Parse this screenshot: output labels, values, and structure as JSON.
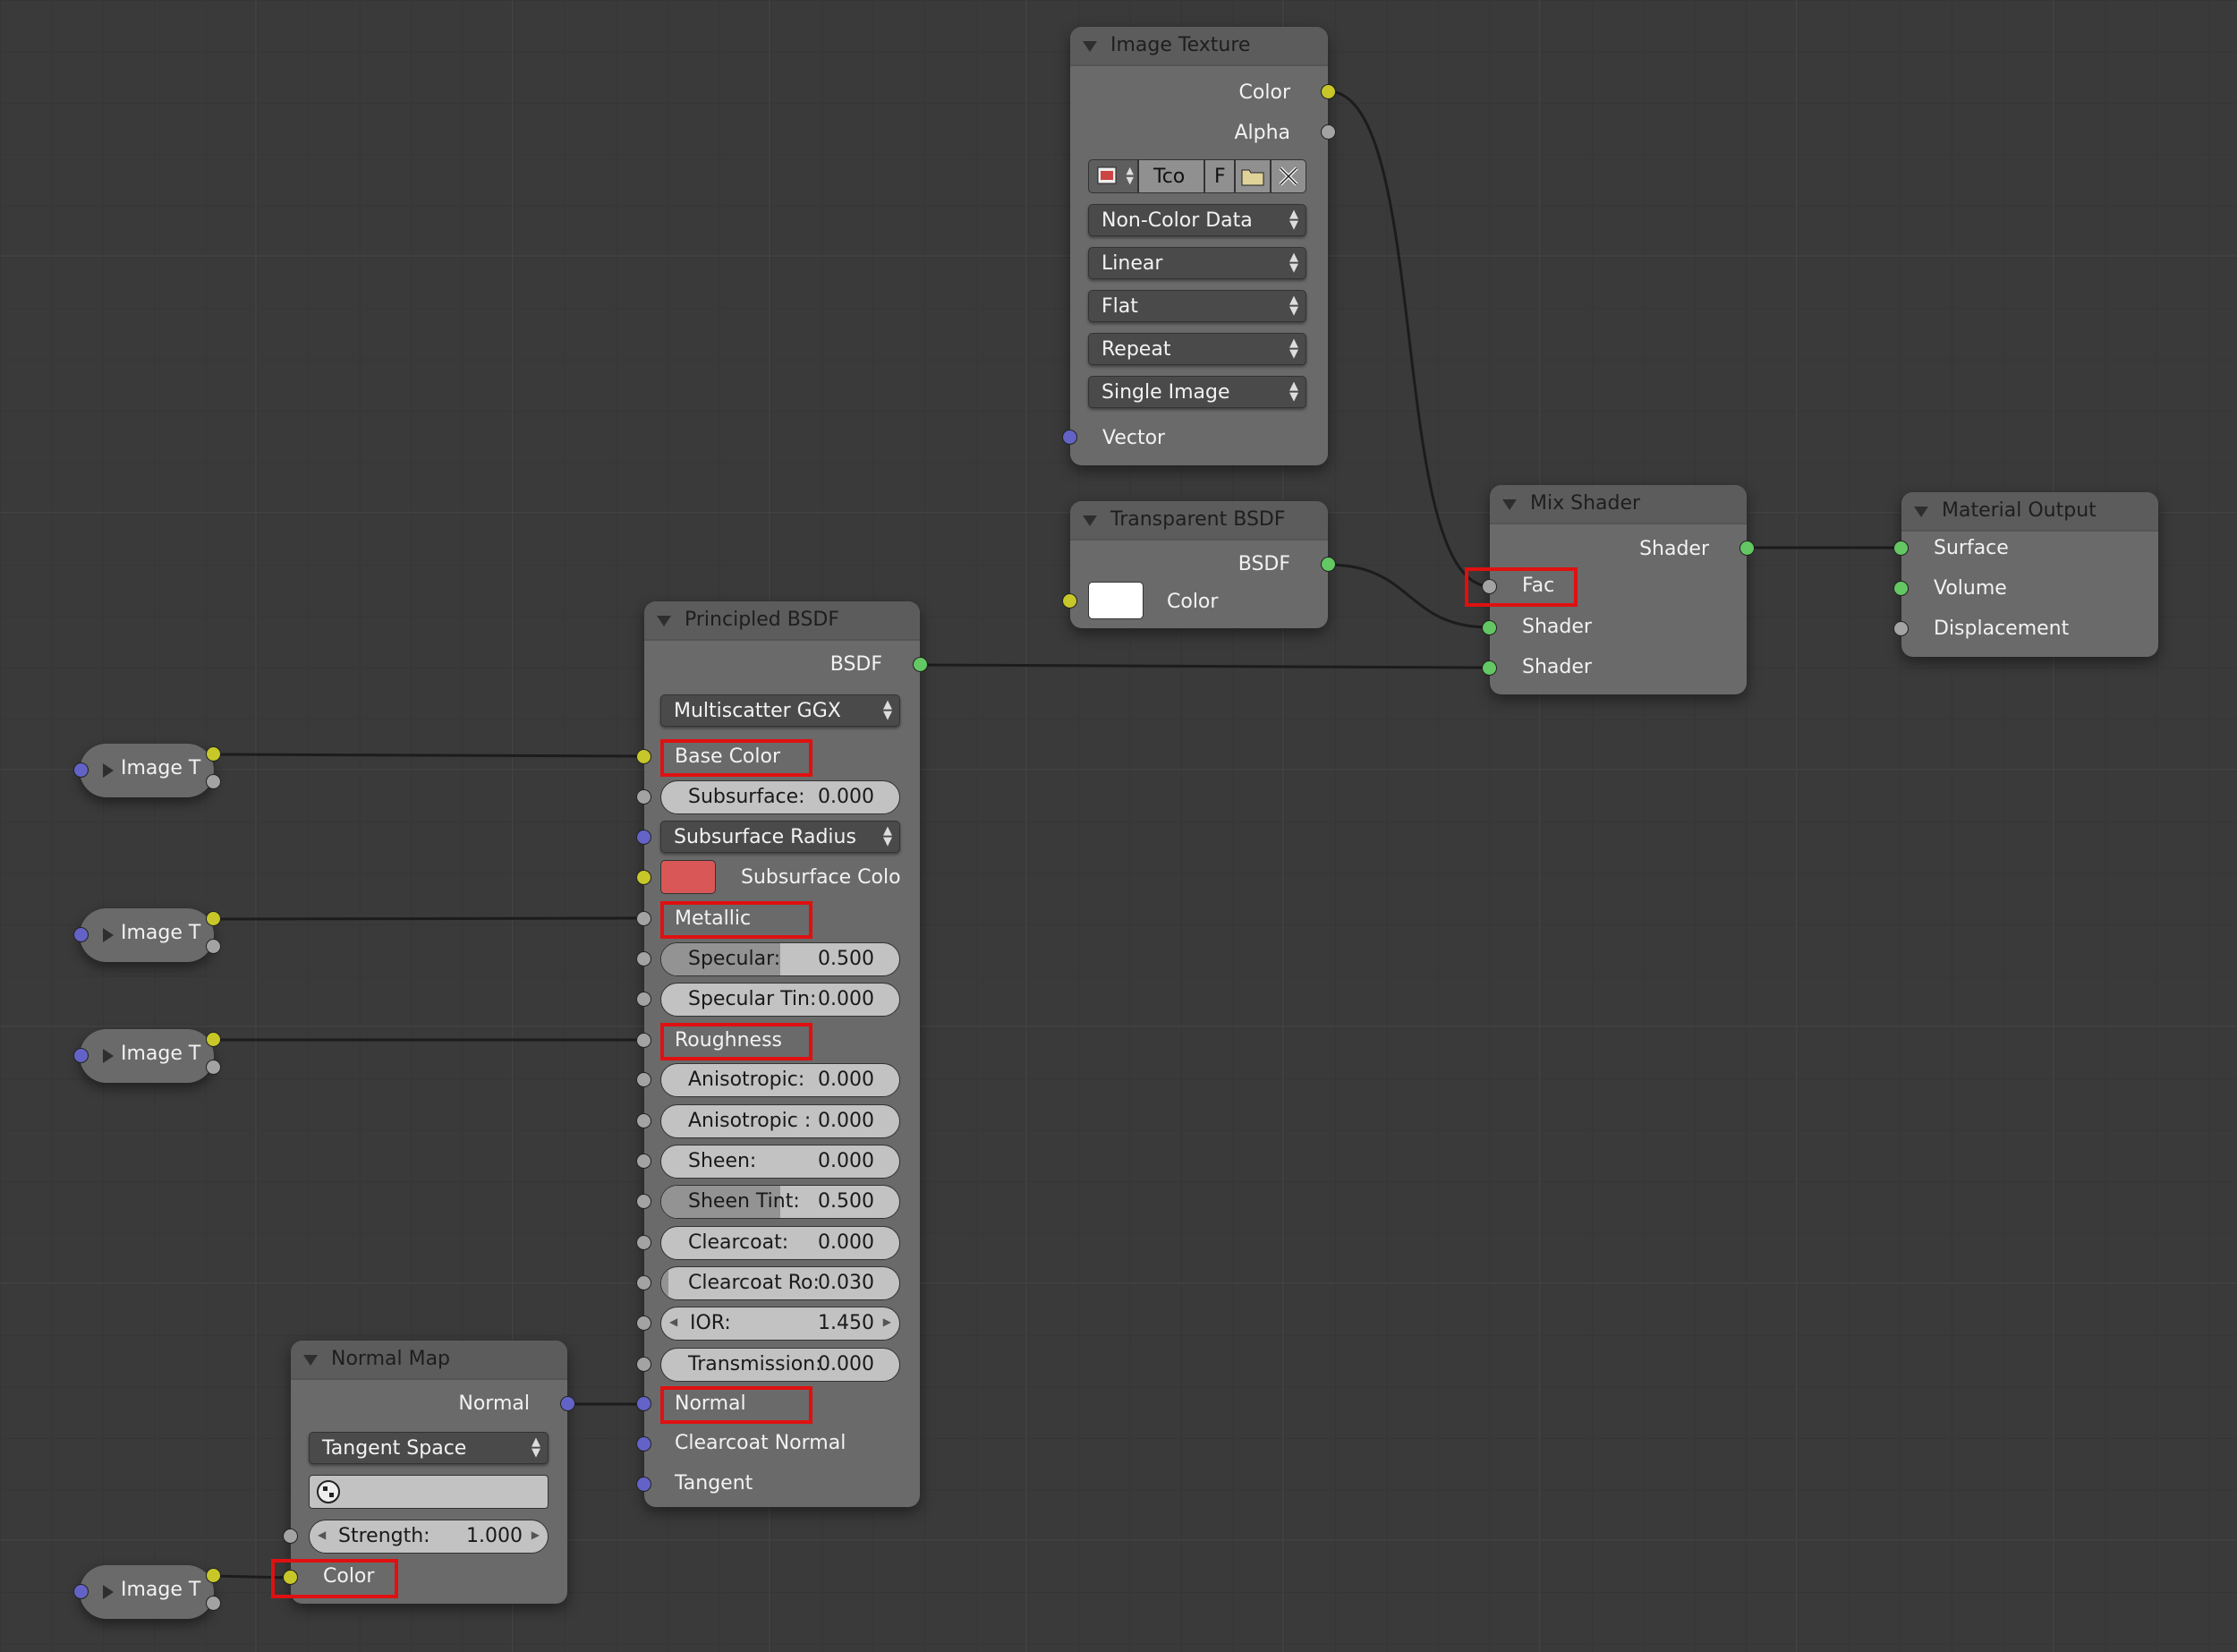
{
  "colors": {
    "socket_color": "#c7c729",
    "socket_shader": "#63c763",
    "socket_float": "#a3a3a3",
    "socket_vector": "#6363c7",
    "highlight": "#e01010",
    "subsurface_color": "#d95757",
    "transparent_color": "#ffffff"
  },
  "image_texture": {
    "title": "Image Texture",
    "out_color": "Color",
    "out_alpha": "Alpha",
    "toolbar": {
      "coord": "Tco",
      "flag": "F"
    },
    "color_space": "Non-Color Data",
    "interpolation": "Linear",
    "projection": "Flat",
    "extension": "Repeat",
    "source": "Single Image",
    "in_vector": "Vector"
  },
  "transparent": {
    "title": "Transparent BSDF",
    "out_bsdf": "BSDF",
    "in_color": "Color"
  },
  "mix": {
    "title": "Mix Shader",
    "out_shader": "Shader",
    "in_fac": "Fac",
    "in_shader1": "Shader",
    "in_shader2": "Shader"
  },
  "output": {
    "title": "Material Output",
    "in_surface": "Surface",
    "in_volume": "Volume",
    "in_displacement": "Displacement"
  },
  "principled": {
    "title": "Principled BSDF",
    "out_bsdf": "BSDF",
    "distribution": "Multiscatter GGX",
    "base_color": "Base Color",
    "subsurface": {
      "label": "Subsurface:",
      "value": "0.000"
    },
    "subsurface_radius": "Subsurface Radius",
    "subsurface_color": "Subsurface Colo",
    "metallic": "Metallic",
    "specular": {
      "label": "Specular:",
      "value": "0.500"
    },
    "specular_tint": {
      "label": "Specular Tin:",
      "value": "0.000"
    },
    "roughness": "Roughness",
    "anisotropic": {
      "label": "Anisotropic:",
      "value": "0.000"
    },
    "anisotropic_rot": {
      "label": "Anisotropic :",
      "value": "0.000"
    },
    "sheen": {
      "label": "Sheen:",
      "value": "0.000"
    },
    "sheen_tint": {
      "label": "Sheen Tint:",
      "value": "0.500"
    },
    "clearcoat": {
      "label": "Clearcoat:",
      "value": "0.000"
    },
    "clearcoat_rough": {
      "label": "Clearcoat Ro:",
      "value": "0.030"
    },
    "ior": {
      "label": "IOR:",
      "value": "1.450"
    },
    "transmission": {
      "label": "Transmission:",
      "value": "0.000"
    },
    "normal": "Normal",
    "clearcoat_normal": "Clearcoat Normal",
    "tangent": "Tangent"
  },
  "normal_map": {
    "title": "Normal Map",
    "out_normal": "Normal",
    "space": "Tangent Space",
    "strength": {
      "label": "Strength:",
      "value": "1.000"
    },
    "in_color": "Color"
  },
  "collapsed_nodes": [
    {
      "label": "Image T"
    },
    {
      "label": "Image T"
    },
    {
      "label": "Image T"
    },
    {
      "label": "Image T"
    }
  ]
}
